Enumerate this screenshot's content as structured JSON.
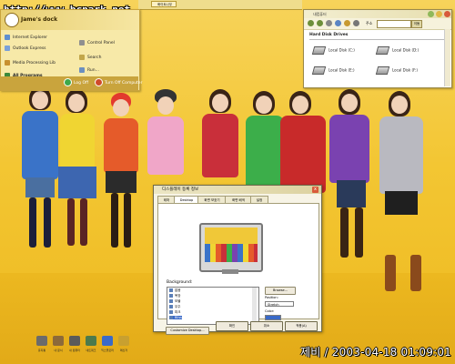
{
  "watermark": "http://www.bcpark.net",
  "start_menu": {
    "user": "Jame's dock",
    "items": [
      {
        "label": "Internet Explorer",
        "icon": "ie-icon"
      },
      {
        "label": "Outlook Express",
        "icon": "mail-icon"
      },
      {
        "label": "Media Processing Lib",
        "icon": "media-icon"
      },
      {
        "label": "All Programs",
        "icon": "programs-icon"
      }
    ],
    "right_items": [
      "Control Panel",
      "Search",
      "Run..."
    ],
    "log_off": "Log Off",
    "turn_off": "Turn Off Computer"
  },
  "taskbar": {
    "task_label": "화이트나무"
  },
  "explorer": {
    "title": "내컴퓨터",
    "address_label": "주소",
    "go_label": "이동",
    "section": "Hard Disk Drives",
    "drives": [
      "Local Disk (C:)",
      "Local Disk (D:)",
      "Local Disk (E:)",
      "Local Disk (F:)"
    ]
  },
  "dialog": {
    "title": "디스플레이 등록 정보",
    "close": "x",
    "tabs": [
      "테마",
      "Desktop",
      "화면 보호기",
      "화면 배색",
      "설정"
    ],
    "background_label": "Background:",
    "backgrounds": [
      "없음",
      "목장",
      "보물",
      "우주",
      "피크",
      "Bliss"
    ],
    "browse": "Browse...",
    "position_label": "Position:",
    "position_value": "Stretch",
    "color_label": "Color:",
    "customize": "Customize Desktop...",
    "ok": "확인",
    "cancel": "취소",
    "apply": "적용(A)"
  },
  "desktop_icons": [
    "휴지통",
    "내 문서",
    "내 컴퓨터",
    "네트워크",
    "익스플로러",
    "메신저"
  ],
  "clock": "제비 / 2003-04-18 01:09:01",
  "colors": {
    "wallpaper": "#f3c633",
    "start_menu": "#f7e9a8",
    "accent": "#c9a43d"
  }
}
